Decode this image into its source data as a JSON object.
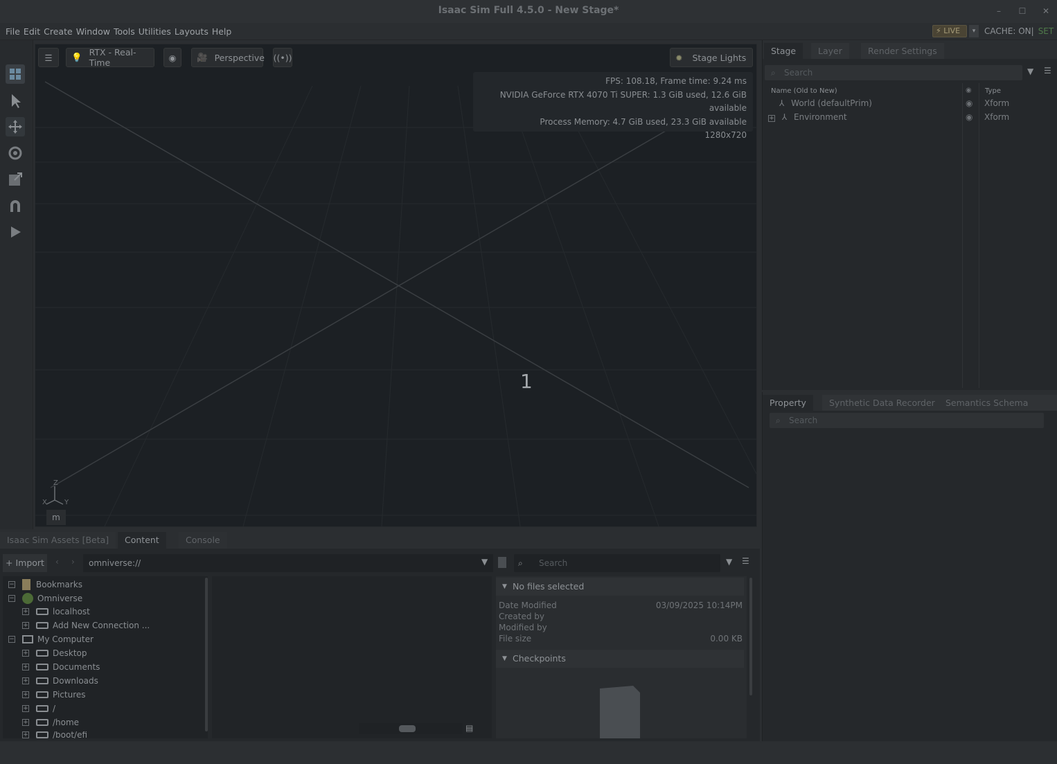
{
  "window": {
    "title": "Isaac Sim Full 4.5.0 - New Stage*",
    "controls": [
      "–",
      "☐",
      "✕"
    ]
  },
  "menubar": {
    "items": [
      "File",
      "Edit",
      "Create",
      "Window",
      "Tools",
      "Utilities",
      "Layouts",
      "Help"
    ],
    "live_label": "LIVE",
    "cache_label": "CACHE: ON|",
    "set_label": "SET"
  },
  "viewport": {
    "renderer_label": "RTX - Real-Time",
    "camera_label": "Perspective",
    "lights_label": "Stage Lights",
    "stats": {
      "fps": "FPS: 108.18, Frame time: 9.24 ms",
      "gpu": "NVIDIA GeForce RTX 4070 Ti SUPER: 1.3 GiB used, 12.6 GiB available",
      "memory": "Process Memory: 4.7 GiB used, 23.3 GiB available",
      "resolution": "1280x720"
    },
    "center_label": "1",
    "axis_z": "Z",
    "axis_x": "X",
    "axis_y": "Y",
    "unit": "m"
  },
  "stage_panel": {
    "tabs": [
      "Stage",
      "Layer",
      "Render Settings"
    ],
    "search_placeholder": "Search",
    "col_name": "Name (Old to New)",
    "col_type": "Type",
    "rows": [
      {
        "name": "World (defaultPrim)",
        "type": "Xform"
      },
      {
        "name": "Environment",
        "type": "Xform"
      }
    ]
  },
  "property_panel": {
    "tabs": [
      "Property",
      "Synthetic Data Recorder",
      "Semantics Schema Editor"
    ],
    "search_placeholder": "Search"
  },
  "bottom_panel": {
    "tabs": [
      "Isaac Sim Assets [Beta]",
      "Content",
      "Console"
    ],
    "import_label": "Import",
    "path": "omniverse://",
    "search_placeholder": "Search",
    "tree": [
      {
        "label": "Bookmarks",
        "sign": "−"
      },
      {
        "label": "Omniverse",
        "sign": "−"
      },
      {
        "label": "localhost",
        "sign": "+"
      },
      {
        "label": "Add New Connection ...",
        "sign": "+"
      },
      {
        "label": "My Computer",
        "sign": "−"
      },
      {
        "label": "Desktop",
        "sign": "+"
      },
      {
        "label": "Documents",
        "sign": "+"
      },
      {
        "label": "Downloads",
        "sign": "+"
      },
      {
        "label": "Pictures",
        "sign": "+"
      },
      {
        "label": "/",
        "sign": "+"
      },
      {
        "label": "/home",
        "sign": "+"
      },
      {
        "label": "/boot/efi",
        "sign": "+"
      }
    ],
    "details": {
      "section_title": "No files selected",
      "date_modified_label": "Date Modified",
      "date_modified_value": "03/09/2025 10:14PM",
      "created_by_label": "Created by",
      "modified_by_label": "Modified by",
      "file_size_label": "File size",
      "file_size_value": "0.00 KB",
      "checkpoints_title": "Checkpoints"
    }
  }
}
